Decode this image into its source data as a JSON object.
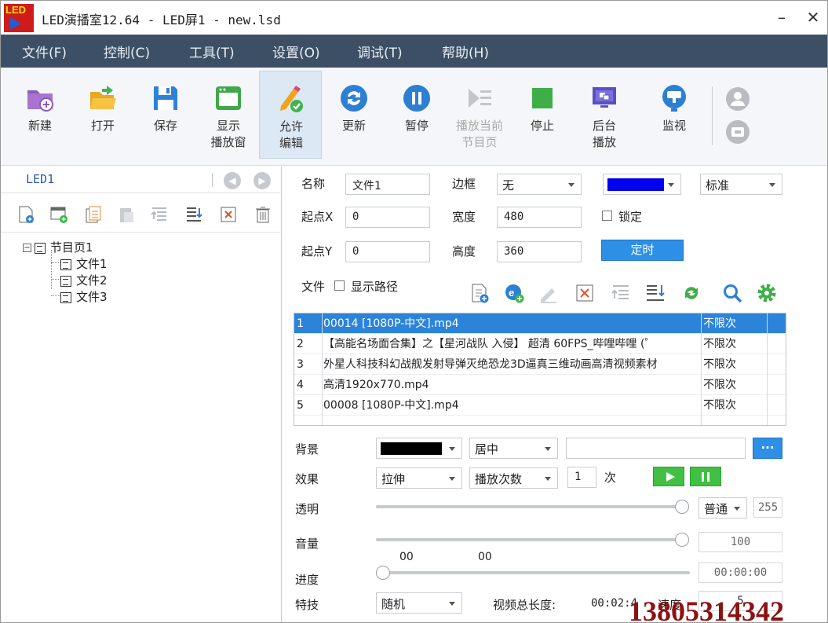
{
  "window": {
    "logo_text": "LED",
    "title": "LED演播室12.64 - LED屏1 - new.lsd",
    "minimize": "–",
    "close": "✕"
  },
  "menu": [
    "文件(F)",
    "控制(C)",
    "工具(T)",
    "设置(O)",
    "调试(T)",
    "帮助(H)"
  ],
  "toolbar": [
    {
      "label": "新建",
      "icon": "new-folder-icon"
    },
    {
      "label": "打开",
      "icon": "open-folder-icon"
    },
    {
      "label": "保存",
      "icon": "save-icon"
    },
    {
      "label": "显示\n播放窗",
      "icon": "display-window-icon"
    },
    {
      "label": "允许\n编辑",
      "icon": "edit-pencil-icon",
      "active": true
    },
    {
      "label": "更新",
      "icon": "refresh-icon"
    },
    {
      "label": "暂停",
      "icon": "pause-icon"
    },
    {
      "label": "播放当前\n节目页",
      "icon": "play-page-icon",
      "disabled": true
    },
    {
      "label": "停止",
      "icon": "stop-icon"
    },
    {
      "label": "后台\n播放",
      "icon": "background-play-icon"
    },
    {
      "label": "监视",
      "icon": "monitor-icon"
    }
  ],
  "left": {
    "screen_name": "LED1",
    "tree": {
      "page": "节目页1",
      "files": [
        "文件1",
        "文件2",
        "文件3"
      ]
    }
  },
  "props": {
    "name_label": "名称",
    "name_value": "文件1",
    "border_label": "边框",
    "border_value": "无",
    "border_color": "#0000ee",
    "style_value": "标准",
    "x_label": "起点X",
    "x_value": "0",
    "width_label": "宽度",
    "width_value": "480",
    "lock_label": "锁定",
    "y_label": "起点Y",
    "y_value": "0",
    "height_label": "高度",
    "height_value": "360",
    "timer_button": "定时",
    "file_label": "文件",
    "show_path_label": "显示路径"
  },
  "files": [
    {
      "index": "1",
      "name": "00014 [1080P-中文].mp4",
      "loop": "不限次",
      "selected": true
    },
    {
      "index": "2",
      "name": "【高能名场面合集】之【星河战队 入侵】 超清 60FPS_哔哩哔哩 (゜",
      "loop": "不限次"
    },
    {
      "index": "3",
      "name": "外星人科技科幻战舰发射导弹灭绝恐龙3D逼真三维动画高清视频素材",
      "loop": "不限次"
    },
    {
      "index": "4",
      "name": "高清1920x770.mp4",
      "loop": "不限次"
    },
    {
      "index": "5",
      "name": "00008 [1080P-中文].mp4",
      "loop": "不限次"
    }
  ],
  "media": {
    "bg_label": "背景",
    "bg_color": "#000000",
    "bg_align": "居中",
    "bg_path": "",
    "browse": "···",
    "effect_label": "效果",
    "effect_value": "拉伸",
    "play_mode": "播放次数",
    "play_count": "1",
    "count_unit": "次",
    "opacity_label": "透明",
    "opacity_mode": "普通",
    "opacity_value": "255",
    "opacity_level": 1.0,
    "volume_label": "音量",
    "volume_value": "100",
    "volume_level": 1.0,
    "progress_start": "00",
    "progress_end": "00",
    "progress_label": "进度",
    "progress_time": "00:00:00",
    "progress_level": 0.0,
    "fx_label": "特技",
    "fx_value": "随机",
    "total_label": "视频总长度:",
    "total_value": "00:02:4",
    "speed_label": "速度",
    "speed_value": "5"
  },
  "overlay": {
    "phone": "13805314342"
  }
}
